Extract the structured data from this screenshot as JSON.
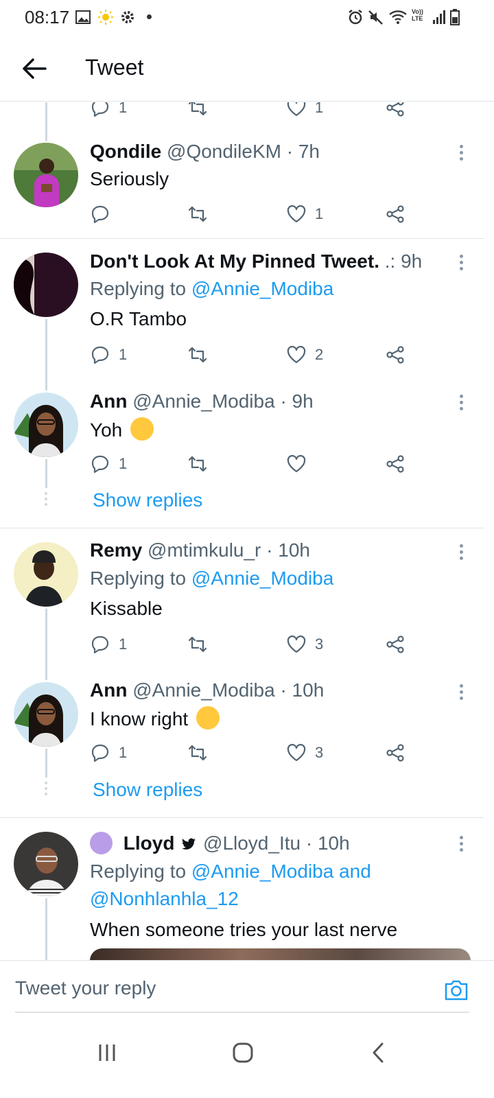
{
  "status_bar": {
    "time": "08:17",
    "icons": [
      "gallery-icon",
      "sun-icon",
      "settings-icon",
      "notification-dot",
      "alarm-icon",
      "mute-icon",
      "wifi-icon",
      "volte-icon",
      "signal-icon",
      "battery-icon"
    ],
    "volte_label": "Vo)) LTE"
  },
  "header": {
    "title": "Tweet",
    "back_icon": "arrow-left-icon"
  },
  "partial_top_actions": {
    "reply_count": "1",
    "like_count": "1"
  },
  "tweets": [
    {
      "name": "Qondile",
      "handle": "@QondileKM",
      "time": "· 7h",
      "text": "Seriously",
      "reply_count": "",
      "retweet_count": "",
      "like_count": "1"
    },
    {
      "name": "Don't Look At My Pinned Tweet.",
      "handle": ".:",
      "time": "9h",
      "replying_prefix": "Replying to",
      "replying_to": "@Annie_Modiba",
      "text": "O.R Tambo",
      "reply_count": "1",
      "retweet_count": "",
      "like_count": "2"
    },
    {
      "name": "Ann",
      "handle": "@Annie_Modiba",
      "time": "· 9h",
      "text": "Yoh",
      "reply_count": "1",
      "retweet_count": "",
      "like_count": "",
      "show_replies": "Show replies"
    },
    {
      "name": "Remy",
      "handle": "@mtimkulu_r",
      "time": "· 10h",
      "replying_prefix": "Replying to",
      "replying_to": "@Annie_Modiba",
      "text": "Kissable",
      "reply_count": "1",
      "retweet_count": "",
      "like_count": "3"
    },
    {
      "name": "Ann",
      "handle": "@Annie_Modiba",
      "time": "· 10h",
      "text": "I know right",
      "reply_count": "1",
      "retweet_count": "",
      "like_count": "3",
      "show_replies": "Show replies"
    },
    {
      "name": "Lloyd",
      "handle": "@Lloyd_Itu",
      "time": "· 10h",
      "replying_prefix": "Replying to",
      "replying_to": "@Annie_Modiba and",
      "replying_to_2": "@Nonhlanhla_12",
      "text": "When someone tries your last nerve"
    }
  ],
  "reply_bar": {
    "placeholder": "Tweet your reply"
  },
  "colors": {
    "accent": "#1d9bf0",
    "secondary_text": "#536471",
    "divider": "#dfe3e6"
  }
}
